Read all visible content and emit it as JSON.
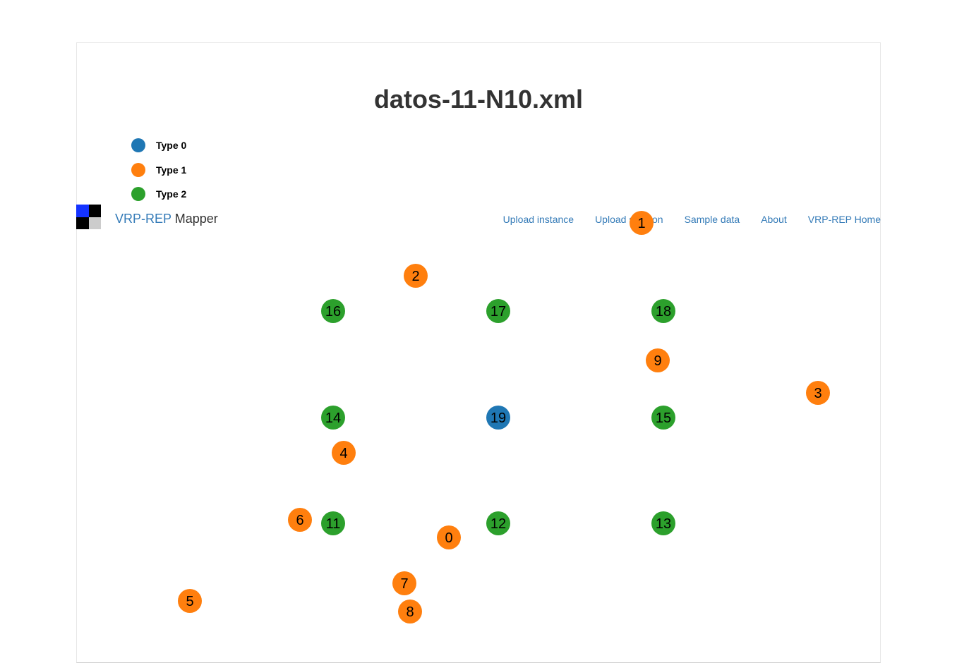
{
  "app": {
    "brand_part1": "VRP-REP",
    "brand_part2": "Mapper"
  },
  "nav": [
    {
      "label": "Upload instance"
    },
    {
      "label": "Upload solution"
    },
    {
      "label": "Sample data"
    },
    {
      "label": "About"
    },
    {
      "label": "VRP-REP Home"
    }
  ],
  "map": {
    "title": "datos-11-N10.xml",
    "legend": [
      {
        "label": "Type 0",
        "color": "#1f77b4"
      },
      {
        "label": "Type 1",
        "color": "#ff7f0e"
      },
      {
        "label": "Type 2",
        "color": "#2ca02c"
      }
    ],
    "logo_colors": [
      "#1433ff",
      "#000000",
      "#000000",
      "#cccccc"
    ],
    "nodes": [
      {
        "id": "0",
        "type": 1
      },
      {
        "id": "1",
        "type": 1
      },
      {
        "id": "2",
        "type": 1
      },
      {
        "id": "3",
        "type": 1
      },
      {
        "id": "4",
        "type": 1
      },
      {
        "id": "5",
        "type": 1
      },
      {
        "id": "6",
        "type": 1
      },
      {
        "id": "7",
        "type": 1
      },
      {
        "id": "8",
        "type": 1
      },
      {
        "id": "9",
        "type": 1
      },
      {
        "id": "11",
        "type": 2
      },
      {
        "id": "12",
        "type": 2
      },
      {
        "id": "13",
        "type": 2
      },
      {
        "id": "14",
        "type": 2
      },
      {
        "id": "15",
        "type": 2
      },
      {
        "id": "16",
        "type": 2
      },
      {
        "id": "17",
        "type": 2
      },
      {
        "id": "18",
        "type": 2
      },
      {
        "id": "19",
        "type": 0
      }
    ]
  }
}
